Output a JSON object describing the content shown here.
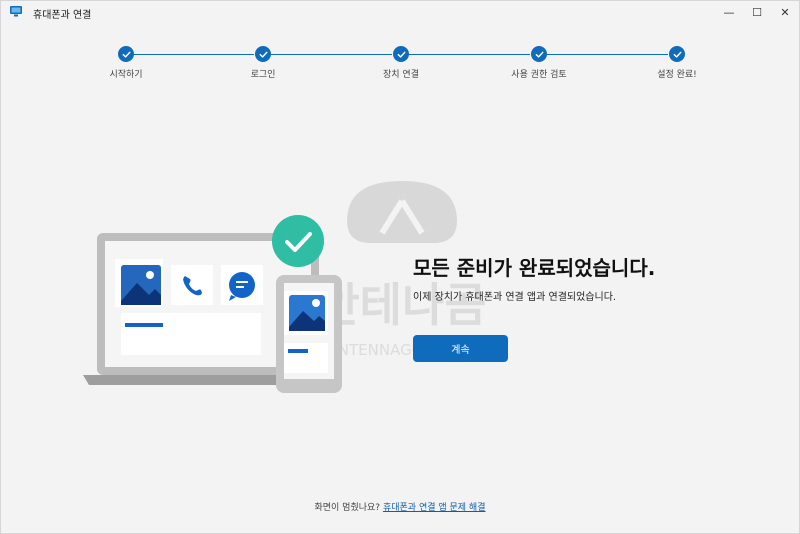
{
  "window": {
    "title": "휴대폰과 연결",
    "minimize_glyph": "—",
    "maximize_glyph": "☐",
    "close_glyph": "✕"
  },
  "steps": [
    {
      "label": "시작하기",
      "status": "complete"
    },
    {
      "label": "로그인",
      "status": "complete"
    },
    {
      "label": "장치 연결",
      "status": "complete"
    },
    {
      "label": "사용 권한 검토",
      "status": "complete"
    },
    {
      "label": "설정 완료!",
      "status": "complete"
    }
  ],
  "main": {
    "headline": "모든 준비가 완료되었습니다.",
    "subtext": "이제 장치가 휴대폰과 연결 앱과 연결되었습니다.",
    "continue_label": "계속"
  },
  "watermark": {
    "text": "안테나곰",
    "subtext": "ANTENNAGOM.COM"
  },
  "footer": {
    "question": "화면이 멈췄나요?",
    "link_label": "휴대폰과 연결 앱 문제 해결"
  },
  "colors": {
    "accent": "#0f6cbd",
    "success": "#2bb6a2",
    "background": "#f3f3f3"
  },
  "icons": [
    "app-icon",
    "checkmark-icon",
    "photo-icon",
    "phone-call-icon",
    "chat-icon"
  ]
}
